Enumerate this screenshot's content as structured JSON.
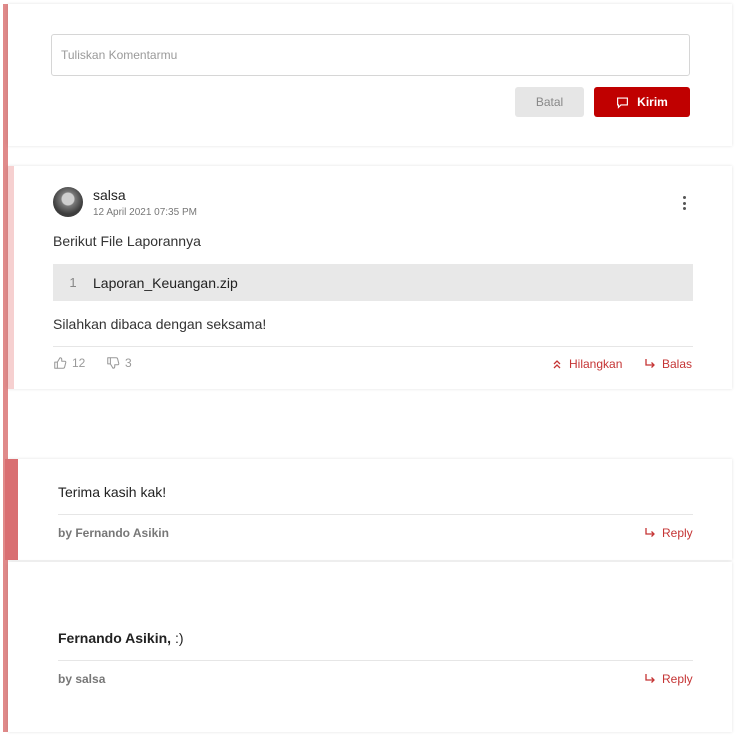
{
  "composer": {
    "placeholder": "Tuliskan Komentarmu",
    "cancel_label": "Batal",
    "submit_label": "Kirim"
  },
  "comment": {
    "author": "salsa",
    "timestamp": "12 April 2021 07:35 PM",
    "text_before": "Berikut File Laporannya",
    "attachment": {
      "index": "1",
      "name": "Laporan_Keuangan.zip"
    },
    "text_after": "Silahkan dibaca dengan seksama!",
    "likes": "12",
    "dislikes": "3",
    "hide_label": "Hilangkan",
    "reply_label": "Balas"
  },
  "replies": [
    {
      "mention": "",
      "text": "Terima kasih kak!",
      "by": "by Fernando Asikin",
      "reply_label": "Reply"
    },
    {
      "mention": "Fernando Asikin,",
      "text": ":)",
      "by": "by salsa",
      "reply_label": "Reply"
    }
  ],
  "colors": {
    "accent": "#c00000",
    "link": "#c53434",
    "rail": "#e08a8a"
  },
  "icons": [
    "comment-icon",
    "kebab-icon",
    "thumbs-up-icon",
    "thumbs-down-icon",
    "chevrons-up-icon",
    "reply-arrow-icon"
  ]
}
